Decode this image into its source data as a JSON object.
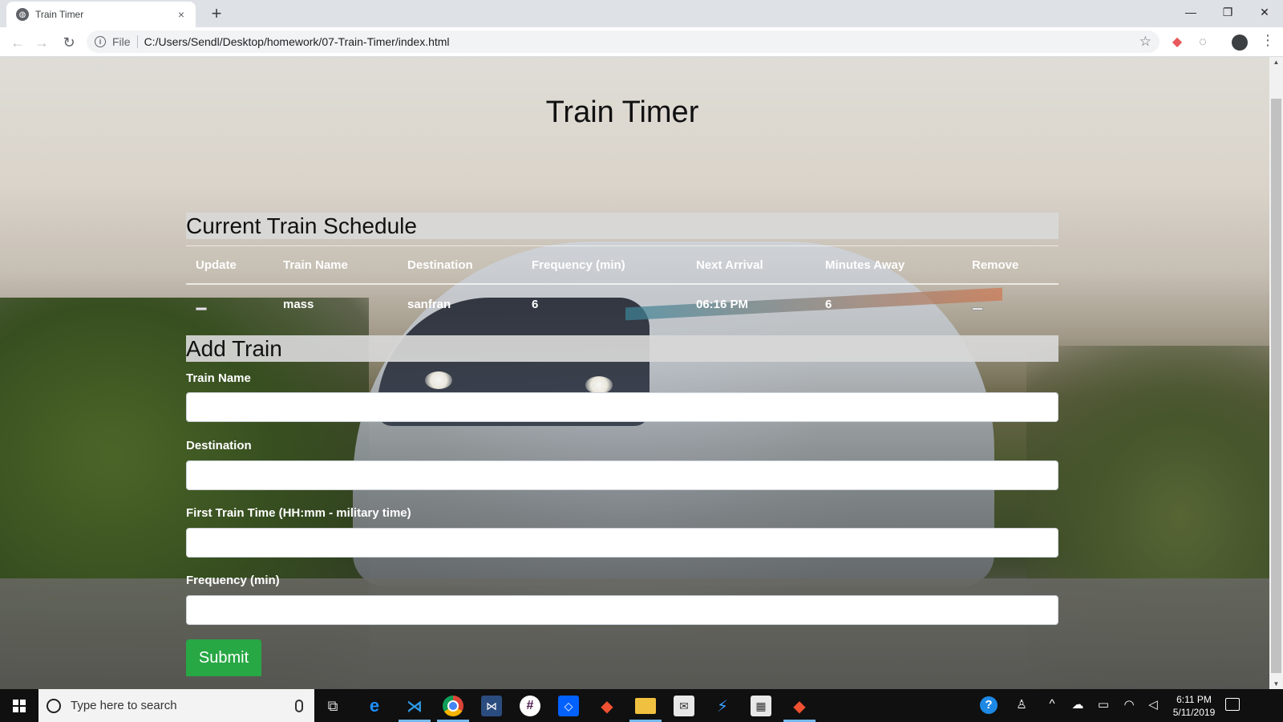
{
  "browser": {
    "tab_title": "Train Timer",
    "tab_close": "×",
    "new_tab": "+",
    "scheme": "File",
    "url": "C:/Users/Sendl/Desktop/homework/07-Train-Timer/index.html"
  },
  "page": {
    "title": "Train Timer"
  },
  "schedule": {
    "header": "Current Train Schedule",
    "columns": [
      "Update",
      "Train Name",
      "Destination",
      "Frequency (min)",
      "Next Arrival",
      "Minutes Away",
      "Remove"
    ],
    "rows": [
      {
        "name": "mass",
        "destination": "sanfran",
        "frequency": "6",
        "next_arrival": "06:16 PM",
        "minutes_away": "6"
      }
    ]
  },
  "form": {
    "header": "Add Train",
    "train_name_label": "Train Name",
    "destination_label": "Destination",
    "first_train_label": "First Train Time (HH:mm - military time)",
    "frequency_label": "Frequency (min)",
    "submit_label": "Submit",
    "train_name_value": "",
    "destination_value": "",
    "first_train_value": "",
    "frequency_value": ""
  },
  "taskbar": {
    "search_placeholder": "Type here to search",
    "time": "6:11 PM",
    "date": "5/11/2019"
  },
  "colors": {
    "submit_button": "#28a745",
    "section_header_bg": "#d8d8d8",
    "taskbar_bg": "#101010",
    "tabbar_bg": "#dee1e6"
  }
}
